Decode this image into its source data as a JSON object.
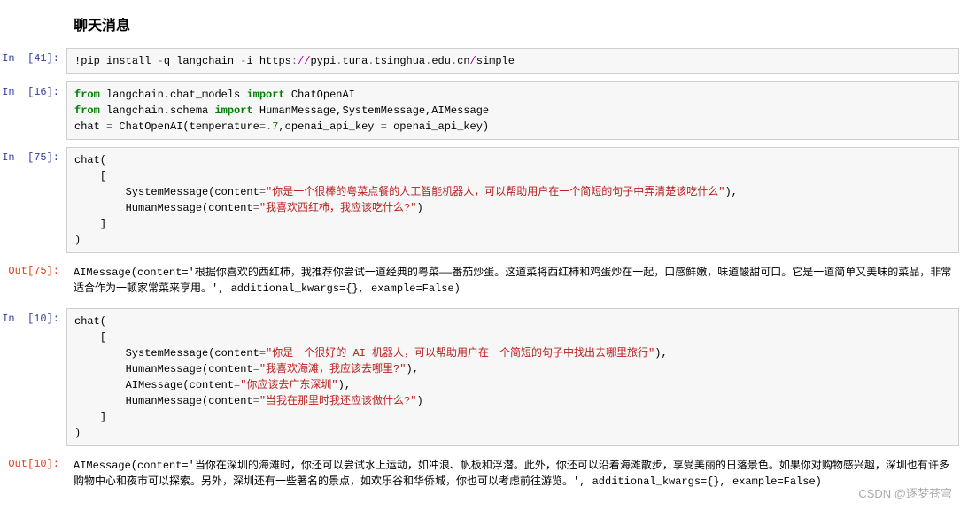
{
  "title": "聊天消息",
  "watermark": "CSDN @逐梦苍穹",
  "cells": [
    {
      "in_prompt": "In  [41]:",
      "code_tokens": [
        {
          "t": "!",
          "c": "k-cmd"
        },
        {
          "t": "pip install ",
          "c": "k-plain"
        },
        {
          "t": "-",
          "c": "k-op"
        },
        {
          "t": "q langchain ",
          "c": "k-plain"
        },
        {
          "t": "-",
          "c": "k-op"
        },
        {
          "t": "i https",
          "c": "k-plain"
        },
        {
          "t": ":",
          "c": "k-op"
        },
        {
          "t": "//",
          "c": "k-purple"
        },
        {
          "t": "pypi",
          "c": "k-plain"
        },
        {
          "t": ".",
          "c": "k-op"
        },
        {
          "t": "tuna",
          "c": "k-plain"
        },
        {
          "t": ".",
          "c": "k-op"
        },
        {
          "t": "tsinghua",
          "c": "k-plain"
        },
        {
          "t": ".",
          "c": "k-op"
        },
        {
          "t": "edu",
          "c": "k-plain"
        },
        {
          "t": ".",
          "c": "k-op"
        },
        {
          "t": "cn",
          "c": "k-plain"
        },
        {
          "t": "/",
          "c": "k-purple"
        },
        {
          "t": "simple",
          "c": "k-plain"
        }
      ]
    },
    {
      "in_prompt": "In  [16]:",
      "code_tokens": [
        {
          "t": "from",
          "c": "k-green"
        },
        {
          "t": " langchain",
          "c": "k-plain"
        },
        {
          "t": ".",
          "c": "k-op"
        },
        {
          "t": "chat_models ",
          "c": "k-plain"
        },
        {
          "t": "import",
          "c": "k-green"
        },
        {
          "t": " ChatOpenAI\n",
          "c": "k-plain"
        },
        {
          "t": "from",
          "c": "k-green"
        },
        {
          "t": " langchain",
          "c": "k-plain"
        },
        {
          "t": ".",
          "c": "k-op"
        },
        {
          "t": "schema ",
          "c": "k-plain"
        },
        {
          "t": "import",
          "c": "k-green"
        },
        {
          "t": " HumanMessage,SystemMessage,AIMessage\n",
          "c": "k-plain"
        },
        {
          "t": "chat ",
          "c": "k-plain"
        },
        {
          "t": "=",
          "c": "k-op"
        },
        {
          "t": " ChatOpenAI(temperature",
          "c": "k-plain"
        },
        {
          "t": "=.",
          "c": "k-op"
        },
        {
          "t": "7",
          "c": "k-num"
        },
        {
          "t": ",openai_api_key ",
          "c": "k-plain"
        },
        {
          "t": "=",
          "c": "k-op"
        },
        {
          "t": " openai_api_key)",
          "c": "k-plain"
        }
      ]
    },
    {
      "in_prompt": "In  [75]:",
      "code_tokens": [
        {
          "t": "chat(\n    [\n        SystemMessage(content",
          "c": "k-plain"
        },
        {
          "t": "=",
          "c": "k-op"
        },
        {
          "t": "\"你是一个很棒的粤菜点餐的人工智能机器人，可以帮助用户在一个简短的句子中弄清楚该吃什么\"",
          "c": "k-str"
        },
        {
          "t": "),\n        HumanMessage(content",
          "c": "k-plain"
        },
        {
          "t": "=",
          "c": "k-op"
        },
        {
          "t": "\"我喜欢西红柿，我应该吃什么?\"",
          "c": "k-str"
        },
        {
          "t": ")\n    ]\n)",
          "c": "k-plain"
        }
      ],
      "out_prompt": "Out[75]:",
      "output": "AIMessage(content='根据你喜欢的西红柿，我推荐你尝试一道经典的粤菜——番茄炒蛋。这道菜将西红柿和鸡蛋炒在一起，口感鲜嫩，味道酸甜可口。它是一道简单又美味的菜品，非常适合作为一顿家常菜来享用。', additional_kwargs={}, example=False)"
    },
    {
      "in_prompt": "In  [10]:",
      "code_tokens": [
        {
          "t": "chat(\n    [\n        SystemMessage(content",
          "c": "k-plain"
        },
        {
          "t": "=",
          "c": "k-op"
        },
        {
          "t": "\"你是一个很好的 AI 机器人，可以帮助用户在一个简短的句子中找出去哪里旅行\"",
          "c": "k-str"
        },
        {
          "t": "),\n        HumanMessage(content",
          "c": "k-plain"
        },
        {
          "t": "=",
          "c": "k-op"
        },
        {
          "t": "\"我喜欢海滩，我应该去哪里?\"",
          "c": "k-str"
        },
        {
          "t": "),\n        AIMessage(content",
          "c": "k-plain"
        },
        {
          "t": "=",
          "c": "k-op"
        },
        {
          "t": "\"你应该去广东深圳\"",
          "c": "k-str"
        },
        {
          "t": "),\n        HumanMessage(content",
          "c": "k-plain"
        },
        {
          "t": "=",
          "c": "k-op"
        },
        {
          "t": "\"当我在那里时我还应该做什么?\"",
          "c": "k-str"
        },
        {
          "t": ")\n    ]\n)",
          "c": "k-plain"
        }
      ],
      "out_prompt": "Out[10]:",
      "output": "AIMessage(content='当你在深圳的海滩时，你还可以尝试水上运动，如冲浪、帆板和浮潜。此外，你还可以沿着海滩散步，享受美丽的日落景色。如果你对购物感兴趣，深圳也有许多购物中心和夜市可以探索。另外，深圳还有一些著名的景点，如欢乐谷和华侨城，你也可以考虑前往游览。', additional_kwargs={}, example=False)"
    }
  ]
}
